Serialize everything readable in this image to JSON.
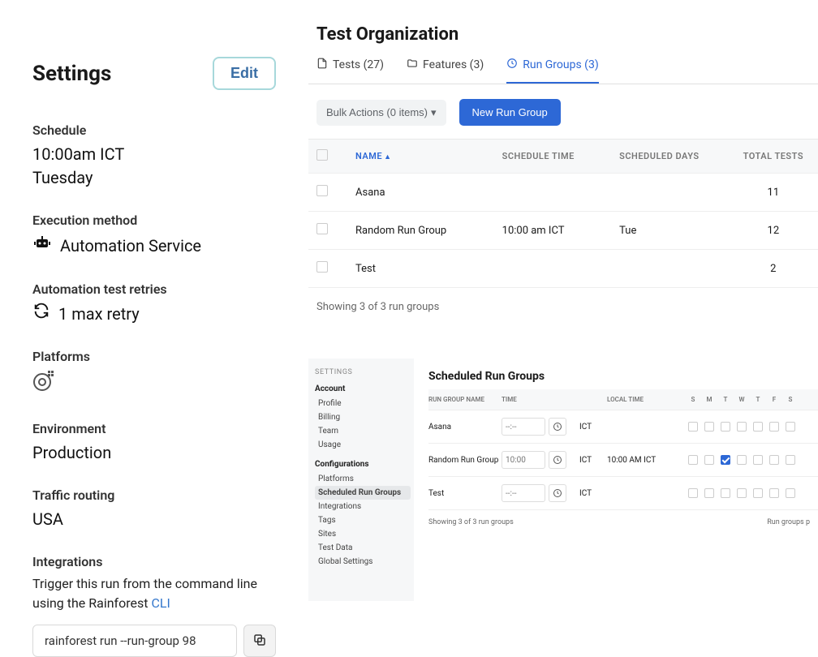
{
  "settings": {
    "title": "Settings",
    "edit_label": "Edit",
    "schedule": {
      "label": "Schedule",
      "time": "10:00am ICT",
      "day": "Tuesday"
    },
    "execution": {
      "label": "Execution method",
      "value": "Automation Service"
    },
    "retries": {
      "label": "Automation test retries",
      "value": "1 max retry"
    },
    "platforms": {
      "label": "Platforms"
    },
    "environment": {
      "label": "Environment",
      "value": "Production"
    },
    "traffic": {
      "label": "Traffic routing",
      "value": "USA"
    },
    "integrations": {
      "label": "Integrations",
      "text_pre": "Trigger this run from the command line using the Rainforest ",
      "link_text": "CLI",
      "cmd": "rainforest run --run-group 98"
    }
  },
  "main": {
    "title": "Test Organization",
    "tabs": {
      "tests": "Tests (27)",
      "features": "Features (3)",
      "rungroups": "Run Groups (3)"
    },
    "bulk": "Bulk Actions (0 items)",
    "new_btn": "New Run Group",
    "columns": {
      "name": "Name",
      "time": "Schedule Time",
      "days": "Scheduled Days",
      "total": "Total Tests"
    },
    "rows": [
      {
        "name": "Asana",
        "time": "",
        "days": "",
        "total": "11"
      },
      {
        "name": "Random Run Group",
        "time": "10:00 am ICT",
        "days": "Tue",
        "total": "12"
      },
      {
        "name": "Test",
        "time": "",
        "days": "",
        "total": "2"
      }
    ],
    "result_text": "Showing 3 of 3 run groups"
  },
  "subpanel": {
    "settings_label": "SETTINGS",
    "account": "Account",
    "account_items": [
      "Profile",
      "Billing",
      "Team",
      "Usage"
    ],
    "config": "Configurations",
    "config_items": [
      "Platforms",
      "Scheduled Run Groups",
      "Integrations",
      "Tags",
      "Sites",
      "Test Data",
      "Global Settings"
    ],
    "active_config_index": 1,
    "title": "Scheduled Run Groups",
    "columns": {
      "name": "Run Group Name",
      "time": "Time",
      "local": "Local Time",
      "days": [
        "S",
        "M",
        "T",
        "W",
        "T",
        "F",
        "S"
      ]
    },
    "tz": "ICT",
    "rows": [
      {
        "name": "Asana",
        "time": "--:--",
        "local": "",
        "days": [
          false,
          false,
          false,
          false,
          false,
          false,
          false
        ]
      },
      {
        "name": "Random Run Group",
        "time": "10:00",
        "local": "10:00 AM ICT",
        "days": [
          false,
          false,
          true,
          false,
          false,
          false,
          false
        ]
      },
      {
        "name": "Test",
        "time": "--:--",
        "local": "",
        "days": [
          false,
          false,
          false,
          false,
          false,
          false,
          false
        ]
      }
    ],
    "footer_left": "Showing 3 of 3 run groups",
    "footer_right": "Run groups p"
  }
}
